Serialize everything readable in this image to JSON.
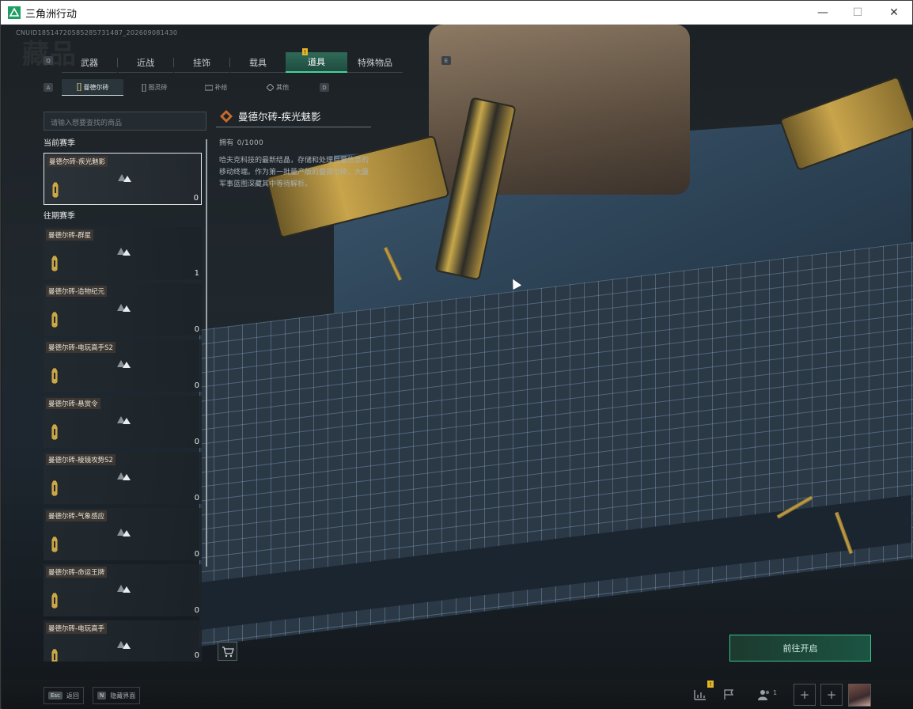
{
  "window": {
    "title": "三角洲行动",
    "controls": {
      "minimize": "—",
      "maximize": "☐",
      "close": "✕"
    }
  },
  "uid_text": "CNUID18514720585285731487_202609081430",
  "page_watermark": "藏品",
  "key_hints": {
    "cat_prev": "Q",
    "cat_next": "E",
    "sub_prev": "A",
    "sub_next": "D"
  },
  "categories": [
    {
      "label": "武器"
    },
    {
      "label": "近战"
    },
    {
      "label": "挂饰"
    },
    {
      "label": "载具"
    },
    {
      "label": "道具",
      "active": true,
      "badge": "!"
    },
    {
      "label": "特殊物品"
    }
  ],
  "sub_tabs": [
    {
      "label": "曼德尔砖",
      "icon": "brick-icon",
      "active": true
    },
    {
      "label": "图灵砖",
      "icon": "card-icon"
    },
    {
      "label": "补给",
      "icon": "supply-icon"
    },
    {
      "label": "其他",
      "icon": "diamond-icon"
    }
  ],
  "search": {
    "placeholder": "请输入想要查找的商品"
  },
  "sections": {
    "current": "当前赛季",
    "past": "往期赛季"
  },
  "current_items": [
    {
      "name": "曼德尔砖-疾光魅影",
      "count": "0",
      "selected": true
    }
  ],
  "past_items": [
    {
      "name": "曼德尔砖-群星",
      "count": "1"
    },
    {
      "name": "曼德尔砖-造物纪元",
      "count": "0"
    },
    {
      "name": "曼德尔砖-电玩高手S2",
      "count": "0"
    },
    {
      "name": "曼德尔砖-悬赏令",
      "count": "0"
    },
    {
      "name": "曼德尔砖-棱镜攻势S2",
      "count": "0"
    },
    {
      "name": "曼德尔砖-气象感应",
      "count": "0"
    },
    {
      "name": "曼德尔砖-命运王牌",
      "count": "0"
    },
    {
      "name": "曼德尔砖-电玩高手",
      "count": "0"
    }
  ],
  "detail": {
    "title": "曼德尔砖-疾光魅影",
    "owned_label": "拥有",
    "owned_value": "0/1000",
    "description": "哈夫克科技的最新结晶，存储和处理巨量信息的移动终端。作为第一批量产版的曼德尔砖，大量军事蓝图深藏其中等待解析。"
  },
  "actions": {
    "goto": "前往开启"
  },
  "bottom": {
    "esc_key": "Esc",
    "esc_label": "返回",
    "n_key": "N",
    "n_label": "隐藏界面",
    "friends_count": "1",
    "stats_badge": "!"
  },
  "colors": {
    "accent": "#45d29a",
    "gold": "#c8a44b",
    "badge": "#e3b529"
  }
}
